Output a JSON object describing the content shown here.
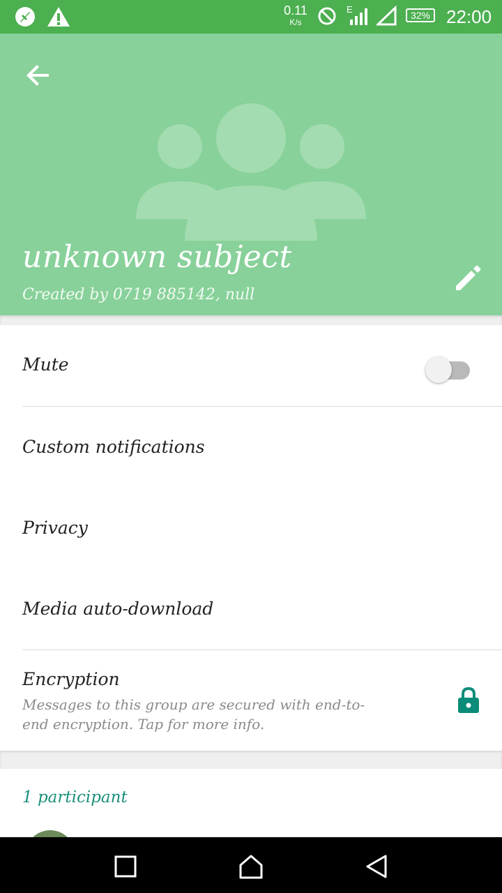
{
  "status_bar": {
    "speed_value": "0.11",
    "speed_unit": "K/s",
    "network_type": "E",
    "battery": "32%",
    "time": "22:00",
    "icons": [
      "navigation-icon",
      "warning-icon",
      "no-disturb-icon",
      "signal-icon",
      "wifi-icon",
      "battery-icon"
    ]
  },
  "header": {
    "subject": "unknown subject",
    "created_by": "Created by 0719 885142, null",
    "background": "#88d19a"
  },
  "settings": {
    "mute_label": "Mute",
    "mute_on": false,
    "custom_notifications_label": "Custom notifications",
    "privacy_label": "Privacy",
    "media_auto_download_label": "Media auto-download",
    "encryption_label": "Encryption",
    "encryption_desc": "Messages to this group are secured with end-to-end encryption. Tap for more info."
  },
  "participants": {
    "count_label": "1 participant"
  },
  "colors": {
    "status_bar": "#4caf50",
    "accent": "#1a8f7b",
    "lock": "#0b8c78"
  }
}
